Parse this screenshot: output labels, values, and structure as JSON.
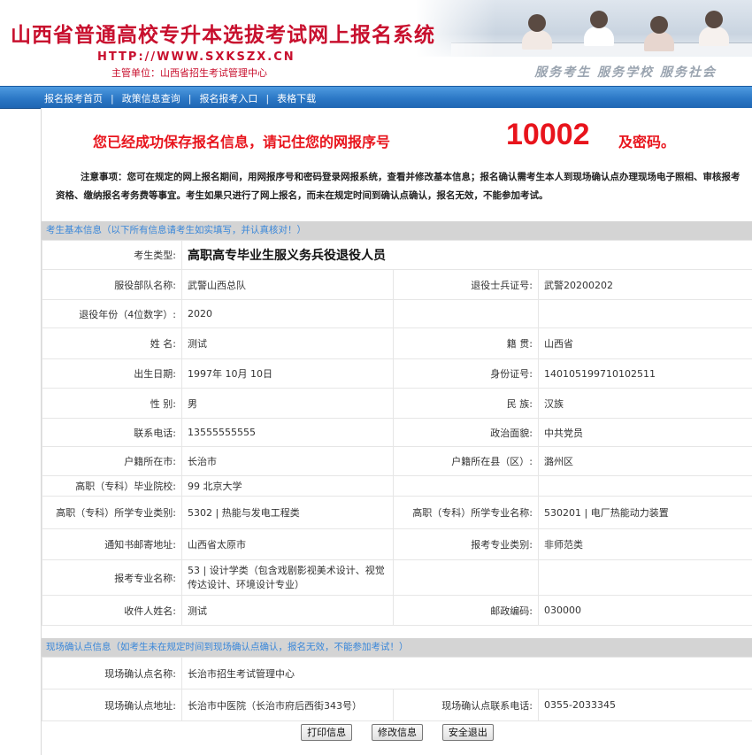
{
  "header": {
    "title": "山西省普通高校专升本选拔考试网上报名系统",
    "url": "HTTP://WWW.SXKSZX.CN",
    "org": "主管单位：山西省招生考试管理中心",
    "slogan": "服务考生   服务学校   服务社会"
  },
  "nav": {
    "items": [
      "报名报考首页",
      "政策信息查询",
      "报名报考入口",
      "表格下载"
    ],
    "separator": "|"
  },
  "notice": {
    "message": "您已经成功保存报名信息，请记住您的网报序号",
    "number": "10002",
    "suffix": "及密码。",
    "text": "注意事项：您可在规定的网上报名期间，用网报序号和密码登录网报系统，查看并修改基本信息；报名确认需考生本人到现场确认点办理现场电子照相、审核报考资格、缴纳报名考务费等事宜。考生如果只进行了网上报名，而未在规定时间到确认点确认，报名无效，不能参加考试。"
  },
  "section_basic": {
    "header": "考生基本信息（以下所有信息请考生如实填写，并认真核对！）",
    "candidate_type_label": "考生类型:",
    "candidate_type_value": "高职高专毕业生服义务兵役退役人员",
    "rows": [
      {
        "l1": "服役部队名称:",
        "v1": "武警山西总队",
        "l2": "退役士兵证号:",
        "v2": "武警20200202"
      },
      {
        "l1": "退役年份（4位数字）:",
        "v1": "2020",
        "l2": "",
        "v2": ""
      },
      {
        "l1": "姓 名:",
        "v1": "测试",
        "l2": "籍 贯:",
        "v2": "山西省"
      },
      {
        "l1": "出生日期:",
        "v1": "1997年 10月 10日",
        "l2": "身份证号:",
        "v2": "140105199710102511"
      },
      {
        "l1": "性 别:",
        "v1": "男",
        "l2": "民 族:",
        "v2": "汉族"
      },
      {
        "l1": "联系电话:",
        "v1": "13555555555",
        "l2": "政治面貌:",
        "v2": "中共党员"
      },
      {
        "l1": "户籍所在市:",
        "v1": "长治市",
        "l2": "户籍所在县（区）:",
        "v2": "潞州区"
      },
      {
        "l1": "高职（专科）毕业院校:",
        "v1": "99 北京大学",
        "l2": "",
        "v2": ""
      },
      {
        "l1": "高职（专科）所学专业类别:",
        "v1": "5302 | 热能与发电工程类",
        "l2": "高职（专科）所学专业名称:",
        "v2": "530201 | 电厂热能动力装置"
      },
      {
        "l1": "通知书邮寄地址:",
        "v1": "山西省太原市",
        "l2": "报考专业类别:",
        "v2": "非师范类"
      },
      {
        "l1": "报考专业名称:",
        "v1": "53 | 设计学类（包含戏剧影视美术设计、视觉传达设计、环境设计专业）",
        "l2": "",
        "v2": ""
      },
      {
        "l1": "收件人姓名:",
        "v1": "测试",
        "l2": "邮政编码:",
        "v2": "030000"
      }
    ]
  },
  "section_confirm": {
    "header": "现场确认点信息（如考生未在规定时间到现场确认点确认，报名无效，不能参加考试！）",
    "rows": [
      {
        "l1": "现场确认点名称:",
        "v1": "长治市招生考试管理中心",
        "l2": "",
        "v2": ""
      },
      {
        "l1": "现场确认点地址:",
        "v1": "长治市中医院（长治市府后西街343号）",
        "l2": "现场确认点联系电话:",
        "v2": "0355-2033345"
      }
    ]
  },
  "buttons": {
    "print": "打印信息",
    "edit": "修改信息",
    "logout": "安全退出"
  }
}
